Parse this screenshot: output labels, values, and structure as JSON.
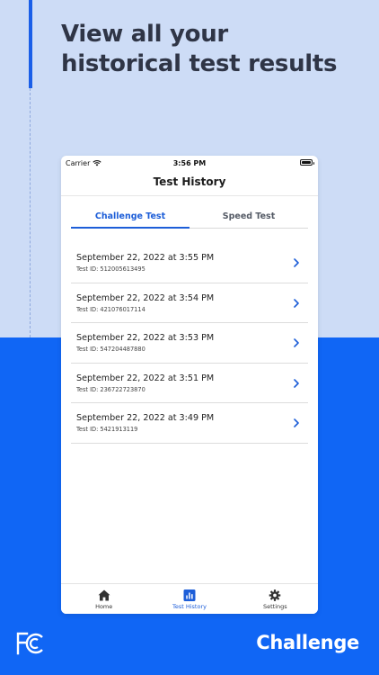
{
  "headline": "View all your historical test results",
  "status_bar": {
    "carrier": "Carrier",
    "time": "3:56 PM"
  },
  "nav": {
    "title": "Test History"
  },
  "tabs": [
    {
      "label": "Challenge Test",
      "active": true
    },
    {
      "label": "Speed Test",
      "active": false
    }
  ],
  "results": [
    {
      "date": "September 22, 2022 at 3:55 PM",
      "test_id": "Test ID: 512005613495"
    },
    {
      "date": "September 22, 2022 at 3:54 PM",
      "test_id": "Test ID: 421076017114"
    },
    {
      "date": "September 22, 2022 at 3:53 PM",
      "test_id": "Test ID: 547204487880"
    },
    {
      "date": "September 22, 2022 at 3:51 PM",
      "test_id": "Test ID: 236722723870"
    },
    {
      "date": "September 22, 2022 at 3:49 PM",
      "test_id": "Test ID: 5421913119"
    }
  ],
  "tabbar": [
    {
      "label": "Home",
      "icon": "home-icon",
      "active": false
    },
    {
      "label": "Test History",
      "icon": "chart-icon",
      "active": true
    },
    {
      "label": "Settings",
      "icon": "gear-icon",
      "active": false
    }
  ],
  "branding": {
    "fcc_logo_text": "FCC",
    "app_logo_text": "Challenge"
  },
  "colors": {
    "accent": "#1d5ed8",
    "top_background": "#cddcf6",
    "bottom_background": "#1066f5",
    "headline": "#2f3546"
  }
}
